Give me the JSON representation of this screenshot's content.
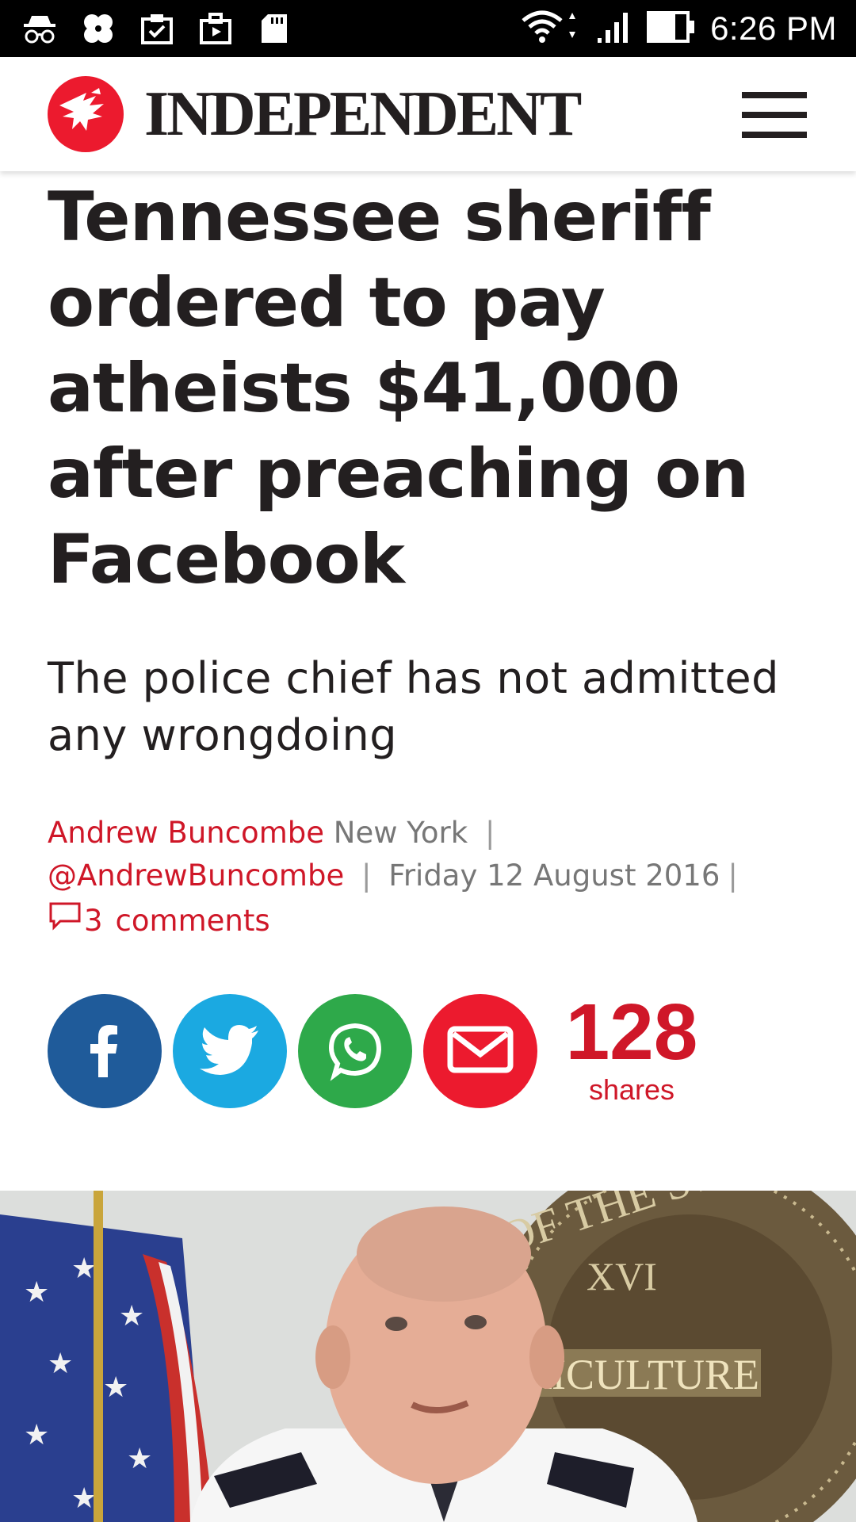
{
  "status_bar": {
    "time": "6:26 PM",
    "left_icons": [
      "incognito-icon",
      "clover-icon",
      "clipboard-check-icon",
      "briefcase-play-icon",
      "sd-card-icon"
    ],
    "right_icons": [
      "wifi-icon",
      "signal-icon",
      "battery-icon"
    ]
  },
  "header": {
    "brand": "INDEPENDENT",
    "logo_icon": "eagle-icon",
    "menu_icon": "hamburger-menu-icon",
    "brand_color": "#ec1a2e"
  },
  "article": {
    "headline": "Tennessee sheriff ordered to pay atheists $41,000 after preaching on Facebook",
    "standfirst": "The police chief has not admitted any wrongdoing",
    "author": "Andrew Buncombe",
    "location": "New York",
    "twitter_handle": "@AndrewBuncombe",
    "date": "Friday 12 August 2016",
    "comments_count": "3",
    "comments_label": "comments"
  },
  "share": {
    "buttons": [
      {
        "name": "facebook",
        "color": "#1f5b9a"
      },
      {
        "name": "twitter",
        "color": "#1ba9e1"
      },
      {
        "name": "whatsapp",
        "color": "#2ea94a"
      },
      {
        "name": "email",
        "color": "#ec1a2e"
      }
    ],
    "count": "128",
    "count_label": "shares"
  },
  "photo": {
    "seal_text": "OF THE STATE OF TENNES",
    "seal_numeral": "XVI",
    "seal_banner": "RICULTURE"
  }
}
